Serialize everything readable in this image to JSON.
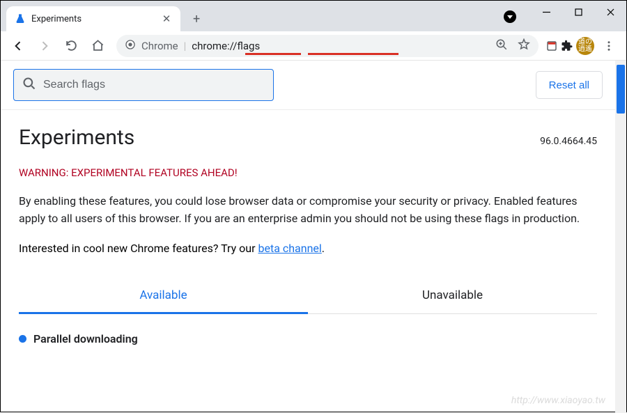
{
  "window": {
    "tab_title": "Experiments"
  },
  "omnibox": {
    "label": "Chrome",
    "url": "chrome://flags"
  },
  "search": {
    "placeholder": "Search flags"
  },
  "buttons": {
    "reset": "Reset all"
  },
  "page": {
    "title": "Experiments",
    "version": "96.0.4664.45",
    "warning": "WARNING: EXPERIMENTAL FEATURES AHEAD!",
    "body": "By enabling these features, you could lose browser data or compromise your security or privacy. Enabled features apply to all users of this browser. If you are an enterprise admin you should not be using these flags in production.",
    "interest_prefix": "Interested in cool new Chrome features? Try our ",
    "interest_link": "beta channel",
    "interest_suffix": "."
  },
  "tabs": {
    "available": "Available",
    "unavailable": "Unavailable"
  },
  "flags": [
    {
      "title": "Parallel downloading"
    }
  ],
  "watermark": "http://www.xiaoyao.tw"
}
